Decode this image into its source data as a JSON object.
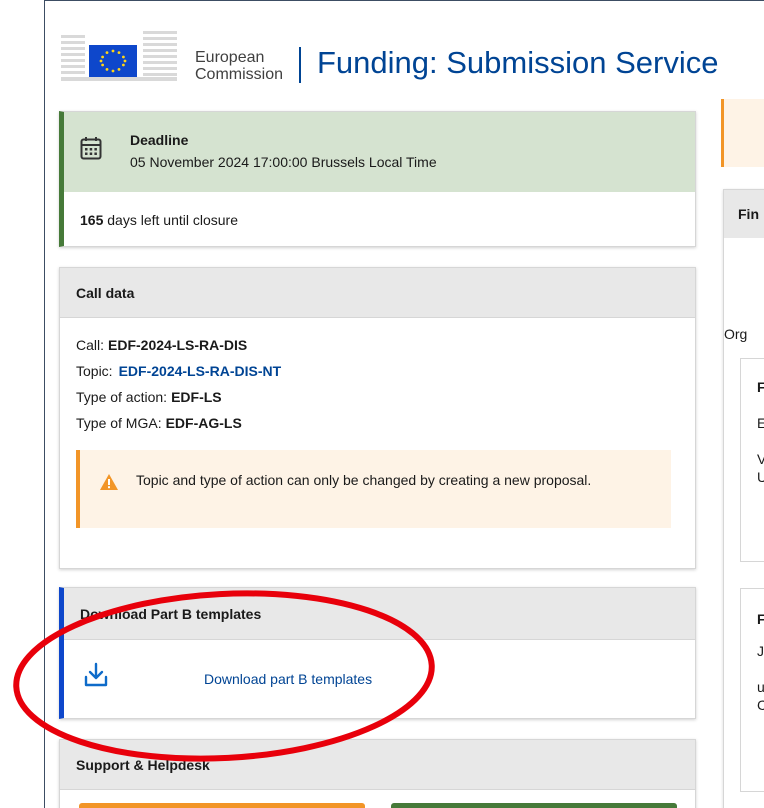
{
  "header": {
    "org_line1": "European",
    "org_line2": "Commission",
    "app_title": "Funding: Submission Service"
  },
  "deadline": {
    "title": "Deadline",
    "date": "05 November 2024 17:00:00 Brussels Local Time",
    "days_left": "165",
    "days_text": "days left until closure"
  },
  "call_data": {
    "heading": "Call data",
    "call_label": "Call:",
    "call_value": "EDF-2024-LS-RA-DIS",
    "topic_label": "Topic:",
    "topic_value": "EDF-2024-LS-RA-DIS-NT",
    "action_label": "Type of action:",
    "action_value": "EDF-LS",
    "mga_label": "Type of MGA:",
    "mga_value": "EDF-AG-LS",
    "warning": "Topic and type of action can only be changed by creating a new proposal."
  },
  "download": {
    "heading": "Download Part B templates",
    "link": "Download part B templates"
  },
  "support": {
    "heading": "Support & Helpdesk"
  },
  "right": {
    "panel_head": "Fin",
    "org_text": "Org",
    "box1_line1": "F",
    "box1_line2": "E",
    "box1_line3": "V",
    "box1_line4": "U",
    "box2_line1": "F",
    "box2_line2": "J",
    "box2_line3": "u",
    "box2_line4": "C"
  },
  "colors": {
    "brand_blue": "#004494",
    "deadline_green": "#467a39",
    "warning_orange": "#f29527",
    "annotation_red": "#e8000b"
  }
}
